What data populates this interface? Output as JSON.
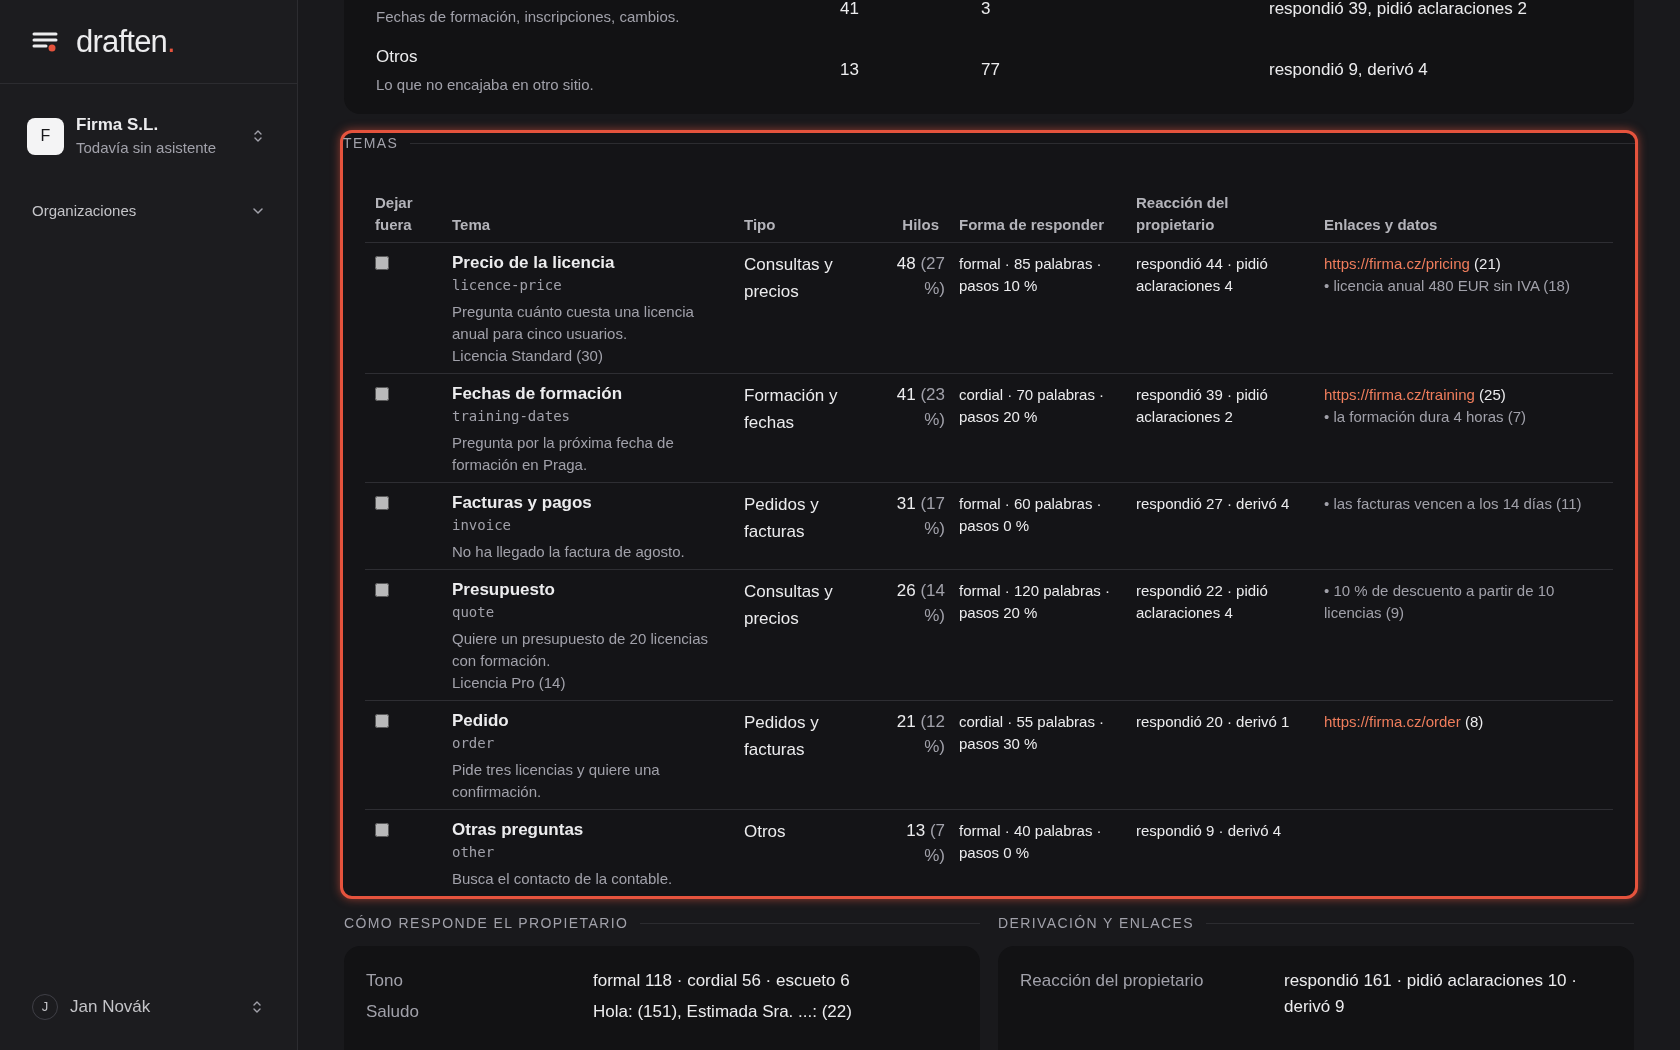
{
  "sidebar": {
    "logo": {
      "text": "draften",
      "dot": "."
    },
    "organization": {
      "initial": "F",
      "name": "Firma S.L.",
      "subtitle": "Todavía sin asistente"
    },
    "nav": [
      {
        "label": "Organizaciones",
        "expanded": false
      }
    ],
    "user": {
      "initial": "J",
      "name": "Jan Novák"
    }
  },
  "summary_rows": [
    {
      "description": "Fechas de formación, inscripciones, cambios.",
      "column_2": "41",
      "column_3": "3",
      "column_4": "respondió 39, pidió aclaraciones 2"
    },
    {
      "name": "Otros",
      "description": "Lo que no encajaba en otro sitio.",
      "column_2": "13",
      "column_3": "77",
      "column_4": "respondió 9, derivó 4"
    }
  ],
  "topics": {
    "title": "TEMAS",
    "highlighted": true,
    "columns": [
      "Dejar fuera",
      "Tema",
      "Tipo",
      "Hilos",
      "Forma de responder",
      "Reacción del propietario",
      "Enlaces y datos"
    ],
    "rows": [
      {
        "excluded": false,
        "title": "Precio de la licencia",
        "slug": "licence-price",
        "description": "Pregunta cuánto cuesta una licencia anual para cinco usuarios.",
        "extra": "Licencia Standard (30)",
        "type": "Consultas y precios",
        "threads": "48",
        "share": "(27 %)",
        "style": "formal · 85 palabras · pasos 10 %",
        "reaction": "respondió 44 · pidió aclaraciones 4",
        "links": [
          {
            "kind": "link",
            "url": "https://firma.cz/pricing",
            "count": "(21)"
          },
          {
            "kind": "fact",
            "text": "• licencia anual 480 EUR sin IVA (18)"
          }
        ]
      },
      {
        "excluded": false,
        "title": "Fechas de formación",
        "slug": "training-dates",
        "description": "Pregunta por la próxima fecha de formación en Praga.",
        "type": "Formación y fechas",
        "threads": "41",
        "share": "(23 %)",
        "style": "cordial · 70 palabras · pasos 20 %",
        "reaction": "respondió 39 · pidió aclaraciones 2",
        "links": [
          {
            "kind": "link",
            "url": "https://firma.cz/training",
            "count": "(25)"
          },
          {
            "kind": "fact",
            "text": "• la formación dura 4 horas (7)"
          }
        ]
      },
      {
        "excluded": false,
        "title": "Facturas y pagos",
        "slug": "invoice",
        "description": "No ha llegado la factura de agosto.",
        "type": "Pedidos y facturas",
        "threads": "31",
        "share": "(17 %)",
        "style": "formal · 60 palabras · pasos 0 %",
        "reaction": "respondió 27 · derivó 4",
        "links": [
          {
            "kind": "fact",
            "text": "• las facturas vencen a los 14 días (11)"
          }
        ]
      },
      {
        "excluded": false,
        "title": "Presupuesto",
        "slug": "quote",
        "description": "Quiere un presupuesto de 20 licencias con formación.",
        "extra": "Licencia Pro (14)",
        "type": "Consultas y precios",
        "threads": "26",
        "share": "(14 %)",
        "style": "formal · 120 palabras · pasos 20 %",
        "reaction": "respondió 22 · pidió aclaraciones 4",
        "links": [
          {
            "kind": "fact",
            "text": "• 10 % de descuento a partir de 10 licencias (9)"
          }
        ]
      },
      {
        "excluded": false,
        "title": "Pedido",
        "slug": "order",
        "description": "Pide tres licencias y quiere una confirmación.",
        "type": "Pedidos y facturas",
        "threads": "21",
        "share": "(12 %)",
        "style": "cordial · 55 palabras · pasos 30 %",
        "reaction": "respondió 20 · derivó 1",
        "links": [
          {
            "kind": "link",
            "url": "https://firma.cz/order",
            "count": "(8)"
          }
        ]
      },
      {
        "excluded": false,
        "title": "Otras preguntas",
        "slug": "other",
        "description": "Busca el contacto de la contable.",
        "type": "Otros",
        "threads": "13",
        "share": "(7 %)",
        "style": "formal · 40 palabras · pasos 0 %",
        "reaction": "respondió 9 · derivó 4"
      }
    ]
  },
  "bottom_sections": [
    {
      "title": "CÓMO RESPONDE EL PROPIETARIO",
      "rows": [
        {
          "label": "Tono",
          "value": "formal 118 · cordial 56 · escueto 6"
        },
        {
          "label": "Saludo",
          "value": "Hola: (151), Estimada Sra. ...: (22)"
        }
      ]
    },
    {
      "title": "DERIVACIÓN Y ENLACES",
      "rows": [
        {
          "label": "Reacción del propietario",
          "value": "respondió 161 · pidió aclaraciones 10 · derivó 9"
        }
      ]
    }
  ]
}
